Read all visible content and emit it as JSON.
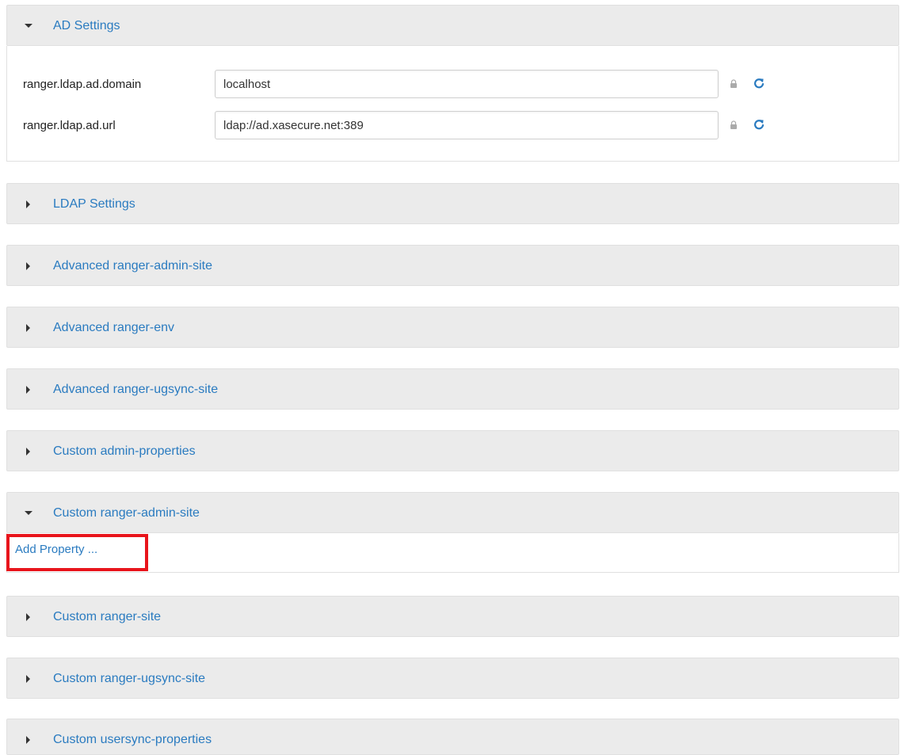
{
  "sections": [
    {
      "title": "AD Settings",
      "expanded": true
    },
    {
      "title": "LDAP Settings",
      "expanded": false
    },
    {
      "title": "Advanced ranger-admin-site",
      "expanded": false
    },
    {
      "title": "Advanced ranger-env",
      "expanded": false
    },
    {
      "title": "Advanced ranger-ugsync-site",
      "expanded": false
    },
    {
      "title": "Custom admin-properties",
      "expanded": false
    },
    {
      "title": "Custom ranger-admin-site",
      "expanded": true
    },
    {
      "title": "Custom ranger-site",
      "expanded": false
    },
    {
      "title": "Custom ranger-ugsync-site",
      "expanded": false
    },
    {
      "title": "Custom usersync-properties",
      "expanded": false
    }
  ],
  "ad_settings": {
    "properties": [
      {
        "label": "ranger.ldap.ad.domain",
        "value": "localhost"
      },
      {
        "label": "ranger.ldap.ad.url",
        "value": "ldap://ad.xasecure.net:389"
      }
    ]
  },
  "custom_admin_site": {
    "add_property_label": "Add Property ..."
  },
  "colors": {
    "link": "#2a7bc0",
    "header_bg": "#ebebeb",
    "highlight": "#e8141b"
  },
  "icons": {
    "expanded": "caret-down-icon",
    "collapsed": "caret-right-icon",
    "lock": "lock-icon",
    "refresh": "refresh-icon"
  }
}
